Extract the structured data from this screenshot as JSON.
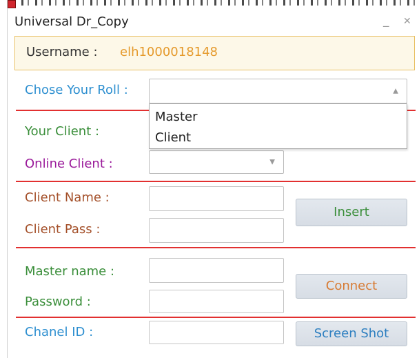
{
  "window": {
    "title": "Universal Dr_Copy",
    "minimize": "_",
    "close": "✕"
  },
  "user": {
    "label": "Username :",
    "value": "elh1000018148"
  },
  "roll": {
    "label": "Chose Your Roll :",
    "value": "",
    "options": [
      "Master",
      "Client"
    ]
  },
  "client_section": {
    "your_client_label": "Your Client :",
    "online_client_label": "Online Client :"
  },
  "insert_section": {
    "client_name_label": "Client Name :",
    "client_pass_label": "Client Pass :",
    "insert_button": "Insert"
  },
  "connect_section": {
    "master_name_label": "Master name :",
    "password_label": "Password :",
    "connect_button": "Connect"
  },
  "chanel_section": {
    "chanel_id_label": "Chanel ID :",
    "screenshot_button": "Screen Shot"
  },
  "icons": {
    "app": "app-icon",
    "dropdown_open": "chevron-up-icon",
    "dropdown_closed": "chevron-down-icon"
  },
  "colors": {
    "separator": "#e23030",
    "username_value": "#e59a2c",
    "blue_label": "#2d8fd0",
    "green_label": "#3a8e3a",
    "purple_label": "#9a1a9a",
    "brown_label": "#a4502a"
  }
}
